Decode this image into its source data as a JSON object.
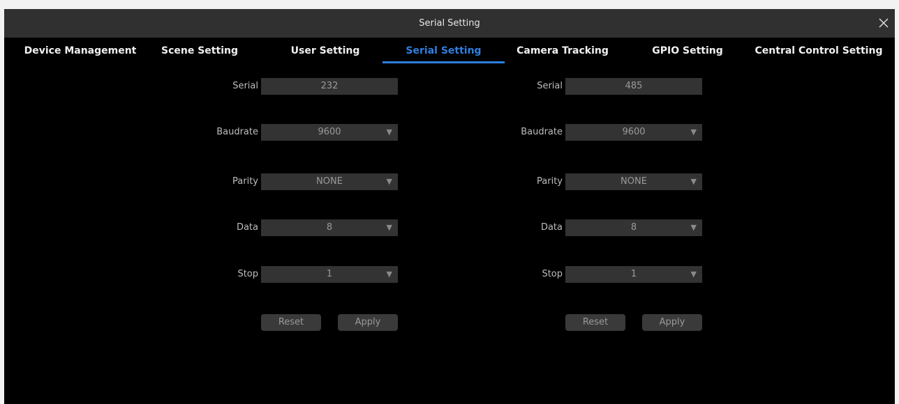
{
  "window": {
    "title": "Serial Setting"
  },
  "tabs": [
    {
      "label": "Device Management"
    },
    {
      "label": "Scene Setting"
    },
    {
      "label": "User Setting"
    },
    {
      "label": "Serial Setting"
    },
    {
      "label": "Camera Tracking"
    },
    {
      "label": "GPIO Setting"
    },
    {
      "label": "Central Control Setting"
    }
  ],
  "active_tab": "Serial Setting",
  "accent_color": "#2f7fe0",
  "panels": [
    {
      "serial_label": "Serial",
      "serial_value": "232",
      "baudrate_label": "Baudrate",
      "baudrate_value": "9600",
      "parity_label": "Parity",
      "parity_value": "NONE",
      "data_label": "Data",
      "data_value": "8",
      "stop_label": "Stop",
      "stop_value": "1",
      "reset_label": "Reset",
      "apply_label": "Apply"
    },
    {
      "serial_label": "Serial",
      "serial_value": "485",
      "baudrate_label": "Baudrate",
      "baudrate_value": "9600",
      "parity_label": "Parity",
      "parity_value": "NONE",
      "data_label": "Data",
      "data_value": "8",
      "stop_label": "Stop",
      "stop_value": "1",
      "reset_label": "Reset",
      "apply_label": "Apply"
    }
  ],
  "icons": {
    "close": "close-icon",
    "dropdown": "dropdown-arrow-icon"
  }
}
